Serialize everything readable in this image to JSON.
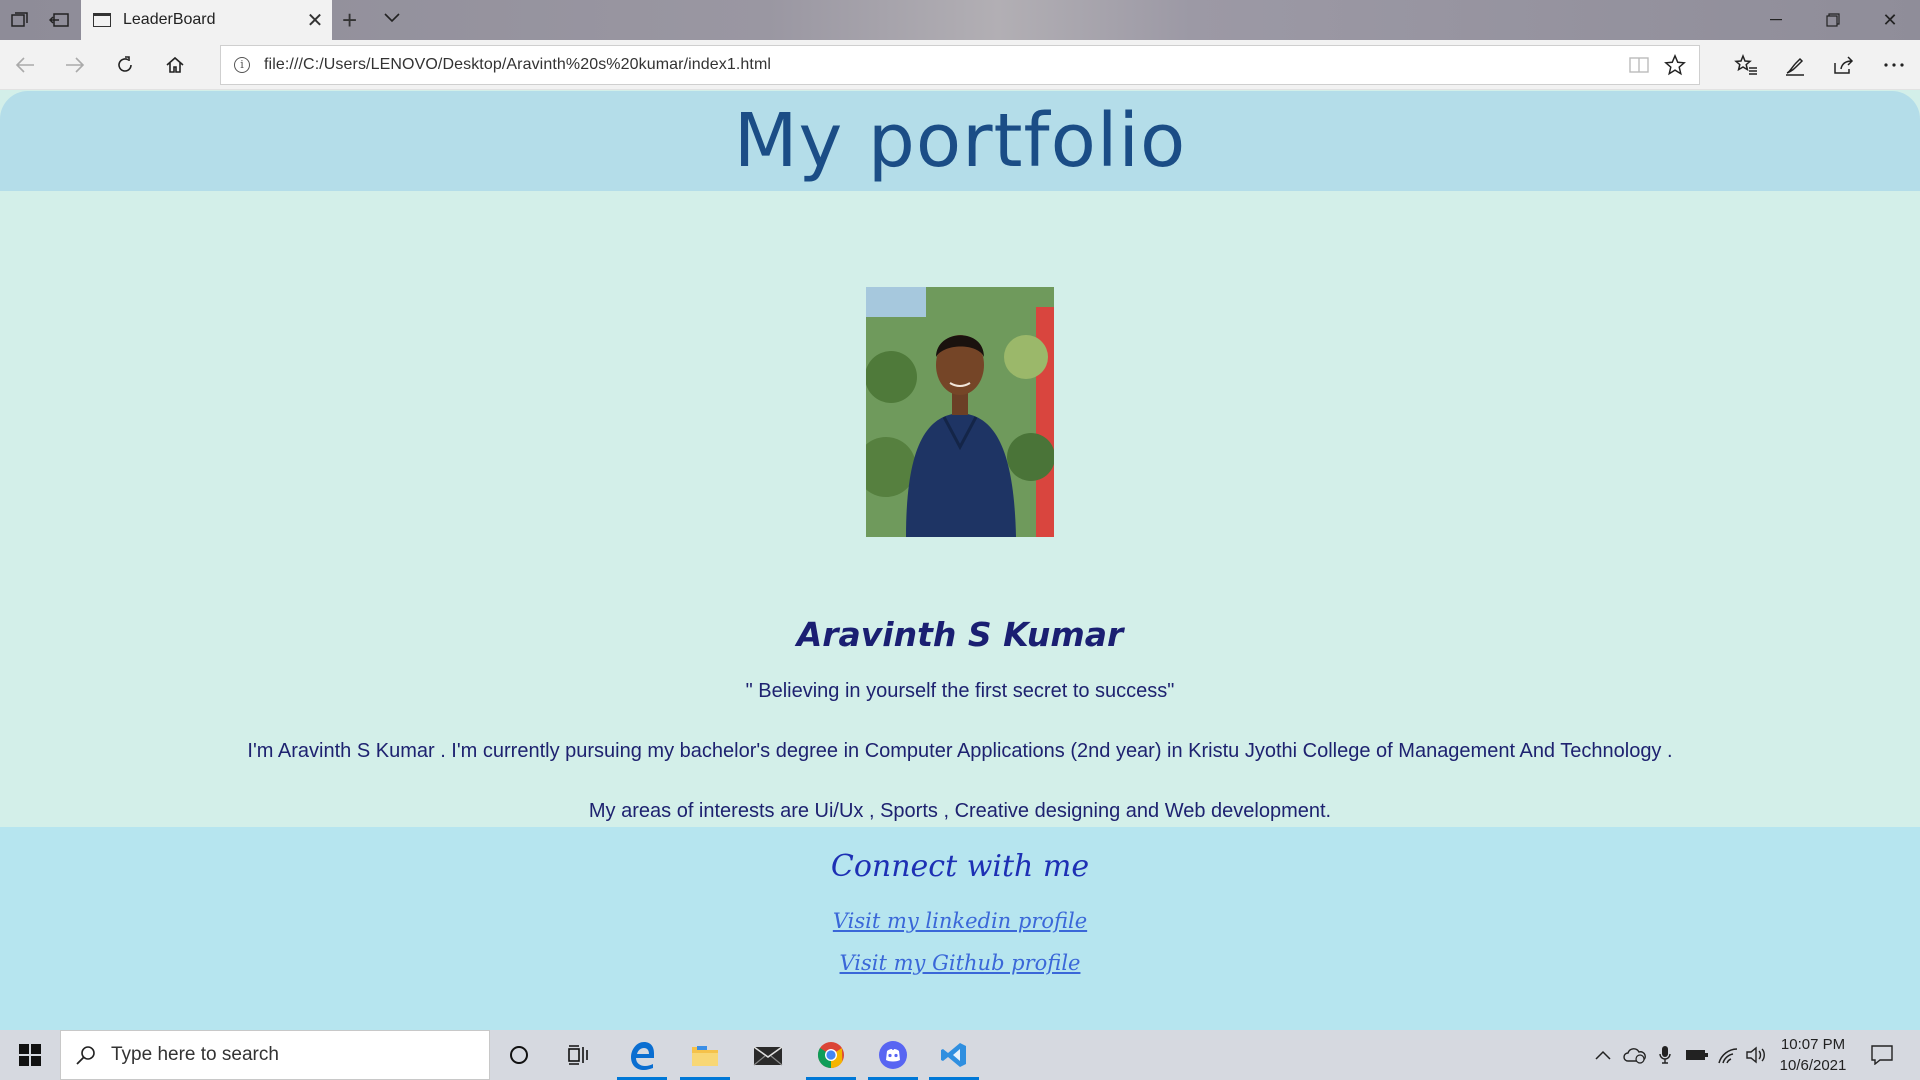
{
  "browser": {
    "tab_title": "LeaderBoard",
    "url": "file:///C:/Users/LENOVO/Desktop/Aravinth%20s%20kumar/index1.html"
  },
  "page": {
    "title": "My portfolio",
    "name": "Aravinth S Kumar",
    "quote": "\" Believing in yourself the first secret to success\"",
    "bio": "I'm Aravinth S Kumar . I'm currently pursuing my bachelor's degree in Computer Applications (2nd year) in Kristu Jyothi College of Management And Technology .",
    "interests": "My areas of interests are Ui/Ux , Sports , Creative designing and Web development.",
    "connect_heading": "Connect with me",
    "links": [
      {
        "label": "Visit my linkedin profile"
      },
      {
        "label": "Visit my Github profile"
      }
    ]
  },
  "taskbar": {
    "search_placeholder": "Type here to search",
    "time": "10:07 PM",
    "date": "10/6/2021",
    "apps": [
      "cortana-icon",
      "task-view-icon",
      "edge-icon",
      "file-explorer-icon",
      "mail-icon",
      "chrome-icon",
      "discord-icon",
      "vscode-icon"
    ]
  },
  "colors": {
    "header_bg": "#b4dde9",
    "content_bg": "#d3efe9",
    "footer_bg": "#b6e5ef",
    "title_color": "#1b4d86",
    "name_color": "#1a1f72",
    "link_color": "#3a67d8"
  }
}
